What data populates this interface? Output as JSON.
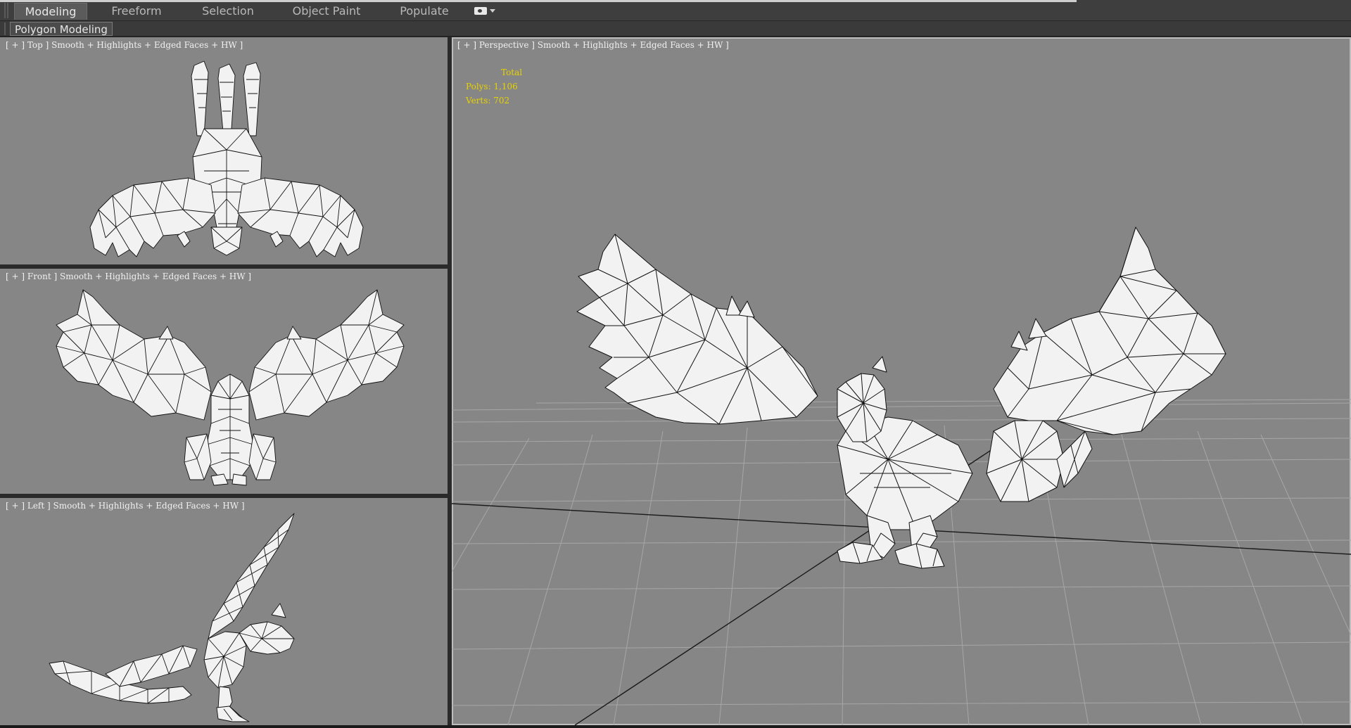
{
  "ribbon": {
    "tabs": [
      {
        "label": "Modeling",
        "active": true
      },
      {
        "label": "Freeform",
        "active": false
      },
      {
        "label": "Selection",
        "active": false
      },
      {
        "label": "Object Paint",
        "active": false
      },
      {
        "label": "Populate",
        "active": false
      }
    ],
    "panel_label": "Polygon Modeling",
    "dropdown_icon": "camera-icon"
  },
  "viewports": {
    "top": {
      "label": "[ + ] Top ] Smooth + Highlights + Edged Faces + HW ]"
    },
    "front": {
      "label": "[ + ] Front ] Smooth + Highlights + Edged Faces + HW ]"
    },
    "left": {
      "label": "[ + ] Left ] Smooth + Highlights + Edged Faces + HW ]"
    },
    "perspective": {
      "label": "[ + ] Perspective ] Smooth + Highlights + Edged Faces + HW ]"
    }
  },
  "stats": {
    "total_label": "Total",
    "polys": "Polys: 1,106",
    "verts": "Verts: 702"
  },
  "colors": {
    "viewport_bg": "#868686",
    "stats_text": "#e8d200",
    "mesh_fill": "#f2f2f2",
    "mesh_wire": "#111111"
  }
}
